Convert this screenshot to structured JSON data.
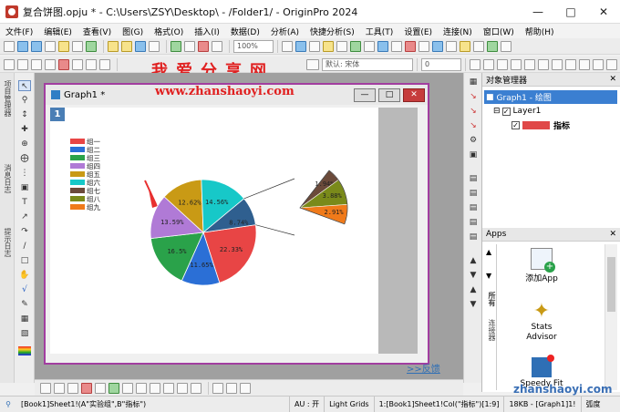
{
  "window": {
    "title": "复合饼图.opju * - C:\\Users\\ZSY\\Desktop\\ - /Folder1/ - OriginPro 2024"
  },
  "menu": [
    "文件(F)",
    "编辑(E)",
    "查看(V)",
    "图(G)",
    "格式(O)",
    "插入(I)",
    "数据(D)",
    "分析(A)",
    "快捷分析(S)",
    "工具(T)",
    "设置(E)",
    "连接(N)",
    "窗口(W)",
    "帮助(H)"
  ],
  "toolbar": {
    "zoom": "100%",
    "font": "默认: 宋体",
    "font_size": "0"
  },
  "watermark": {
    "line1": "我爱分享网",
    "line2": "www.zhanshaoyi.com",
    "bottom": "zhanshaoyi.com"
  },
  "graph_window": {
    "title": "Graph1 *",
    "layer": "1"
  },
  "left_tabs": [
    "项目管理器",
    "消息日志",
    "提示日志"
  ],
  "object_manager": {
    "title": "对象管理器",
    "root": "Graph1 - 绘图",
    "layer": "Layer1",
    "plot": "指标"
  },
  "apps": {
    "title": "Apps",
    "items": [
      "添加App",
      "Stats Advisor",
      "Speedy Fit"
    ],
    "side_tabs": [
      "所有",
      "连接器"
    ]
  },
  "feedback": ">>反馈",
  "status": {
    "cells": [
      "[Book1]Sheet1!(A\"实验组\",B\"指标\")",
      "AU : 开",
      "Light Grids",
      "1:[Book1]Sheet1!Col(\"指标\")[1:9]",
      "18KB - [Graph1]1!",
      "弧度"
    ]
  },
  "colors": {
    "accent": "#2f7ec5",
    "window_border": "#a23ea0",
    "plot_swatch": "#e04848"
  },
  "chart_data": {
    "type": "pie",
    "categories": [
      "组一",
      "组二",
      "组三",
      "组四",
      "组五",
      "组六",
      "组七",
      "组八",
      "组九"
    ],
    "colors": [
      "#e84545",
      "#2b6fd6",
      "#2aa24a",
      "#b07ad6",
      "#c99a15",
      "#17c8c8",
      "#6b4a3a",
      "#7a8a1a",
      "#f07a1a"
    ],
    "values": [
      22.33,
      11.65,
      16.5,
      13.59,
      12.62,
      14.56,
      1.94,
      3.88,
      2.91
    ],
    "main_labels": [
      "22.33%",
      "11.65%",
      "16.5%",
      "13.59%",
      "12.62%",
      "14.56%",
      "8.74%"
    ],
    "sub_labels": [
      "1.94%",
      "3.88%",
      "2.91%"
    ],
    "combined_value": 8.74
  }
}
